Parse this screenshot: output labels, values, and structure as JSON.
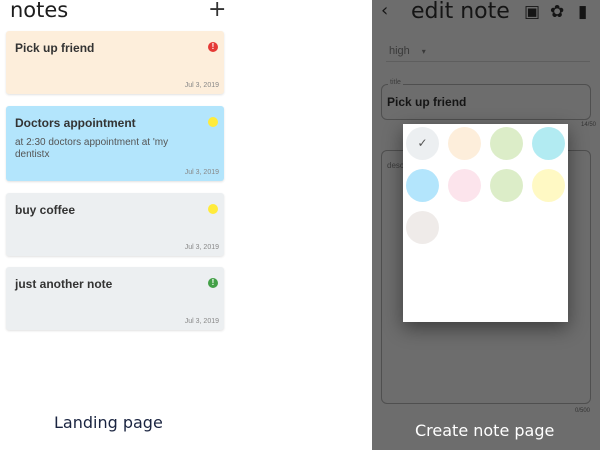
{
  "landing": {
    "title": "notes",
    "add_icon_glyph": "+",
    "caption": "Landing page",
    "notes": [
      {
        "title": "Pick up friend",
        "body": "",
        "date": "Jul 3, 2019",
        "bg": "#fdeedb",
        "priority_color": "#e53935",
        "priority_glyph": "!"
      },
      {
        "title": "Doctors appointment",
        "body": "at 2:30 doctors appointment at 'my dentistx",
        "date": "Jul 3, 2019",
        "bg": "#b3e5fc",
        "priority_color": "#ffeb3b",
        "priority_glyph": ""
      },
      {
        "title": "buy coffee",
        "body": "",
        "date": "Jul 3, 2019",
        "bg": "#eceff1",
        "priority_color": "#ffeb3b",
        "priority_glyph": ""
      },
      {
        "title": "just another note",
        "body": "",
        "date": "Jul 3, 2019",
        "bg": "#eceff1",
        "priority_color": "#43a047",
        "priority_glyph": "!"
      }
    ]
  },
  "create": {
    "header": {
      "back_glyph": "‹",
      "title": "edit note",
      "save_glyph": "▣",
      "palette_glyph": "✿",
      "delete_glyph": "▮"
    },
    "priority": {
      "value": "high",
      "caret": "▾"
    },
    "title_field": {
      "label": "title",
      "value": "Pick up friend",
      "counter": "14/50"
    },
    "description_field": {
      "label": "description",
      "counter": "0/500"
    },
    "caption": "Create note page",
    "overlay_bg": "#6d6d6d",
    "color_picker": {
      "check_glyph": "✓",
      "swatches": [
        "#eceff1",
        "#fdeedb",
        "#dcedc8",
        "#b2ebf2",
        "#b3e5fc",
        "#fce4ec",
        "#dcedc8",
        "#fff9c4",
        "#efebe9"
      ],
      "selected_index": 0
    }
  }
}
